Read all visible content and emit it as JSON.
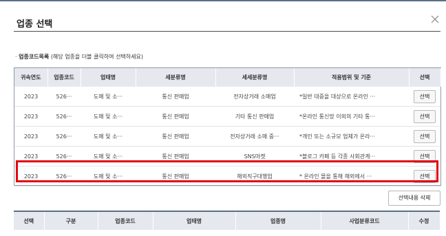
{
  "dialog": {
    "title": "업종 선택",
    "close_icon": "close-icon"
  },
  "section": {
    "label": "업종코드목록",
    "hint": "(해당 업종을 더블 클릭하여 선택하세요)"
  },
  "list_table": {
    "columns": [
      "귀속연도",
      "업종코드",
      "업태명",
      "세분류명",
      "세세분류명",
      "적용범위 및 기준",
      "선택"
    ],
    "rows": [
      {
        "year": "2023",
        "code": "526···",
        "business": "도매 및 소···",
        "subclass": "통신 판매업",
        "detail": "전자상거래 소매업",
        "scope": "*일반 대중을 대상으로 온라인 ···",
        "select": "선택"
      },
      {
        "year": "2023",
        "code": "526···",
        "business": "도매 및 소···",
        "subclass": "통신 판매업",
        "detail": "기타 통신 판매업",
        "scope": "*온라인 통신망 이외의 기타 통···",
        "select": "선택"
      },
      {
        "year": "2023",
        "code": "526···",
        "business": "도매 및 소···",
        "subclass": "통신 판매업",
        "detail": "전자상거래 소매 중···",
        "scope": "*개인 또는 소규모 업체가 온라···",
        "select": "선택"
      },
      {
        "year": "2023",
        "code": "526···",
        "business": "도매 및 소···",
        "subclass": "통신 판매업",
        "detail": "SNS마켓",
        "scope": "*블로그 카페 등 각종 사회관계···",
        "select": "선택"
      },
      {
        "year": "2023",
        "code": "526···",
        "business": "도매 및 소···",
        "subclass": "통신 판매업",
        "detail": "해외직구대행업",
        "scope": "* 온라인 몰을 통해 해외에서 ···",
        "select": "선택"
      }
    ]
  },
  "actions": {
    "delete_selection": "선택내용 삭제"
  },
  "selected_table": {
    "columns": [
      "선택",
      "구분",
      "업종코드",
      "업태명",
      "업종명",
      "사업분류코드",
      "수정"
    ]
  },
  "colors": {
    "highlight": "#e3000f",
    "header_bg": "#e5e8ee",
    "accent_line": "#5a6e88"
  }
}
